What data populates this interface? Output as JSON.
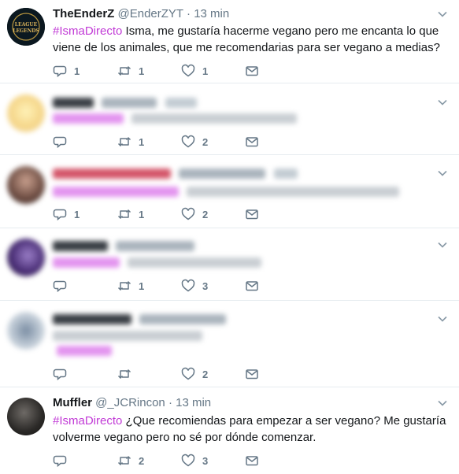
{
  "tweets": [
    {
      "name": "TheEnderZ",
      "handle": "@EnderZYT",
      "dot": "·",
      "time": "13 min",
      "hashtag": "#IsmaDirecto",
      "text_rest": " Isma, me gustaría hacerme vegano pero me encanta lo que viene de los animales, que me recomendarias para ser vegano a medias?",
      "avatar_text": "LEAGUE OF LEGENDS",
      "replies": "1",
      "retweets": "1",
      "likes": "1"
    },
    {
      "replies": "",
      "retweets": "1",
      "likes": "2"
    },
    {
      "replies": "1",
      "retweets": "1",
      "likes": "2"
    },
    {
      "replies": "",
      "retweets": "1",
      "likes": "3"
    },
    {
      "replies": "",
      "retweets": "",
      "likes": "2"
    },
    {
      "name": "Muffler",
      "handle": "@_JCRincon",
      "dot": "·",
      "time": "13 min",
      "hashtag": "#IsmaDirecto",
      "text_rest": " ¿Que recomiendas para empezar a ser vegano? Me gustaría volverme vegano pero no sé por dónde comenzar.",
      "replies": "",
      "retweets": "2",
      "likes": "3"
    }
  ],
  "icons": {
    "reply": "reply-icon",
    "retweet": "retweet-icon",
    "like": "heart-icon",
    "dm": "envelope-icon",
    "caret": "chevron-down-icon"
  },
  "colors": {
    "hashtag": "#c13bd6",
    "muted": "#657786",
    "divider": "#e6ecf0"
  }
}
